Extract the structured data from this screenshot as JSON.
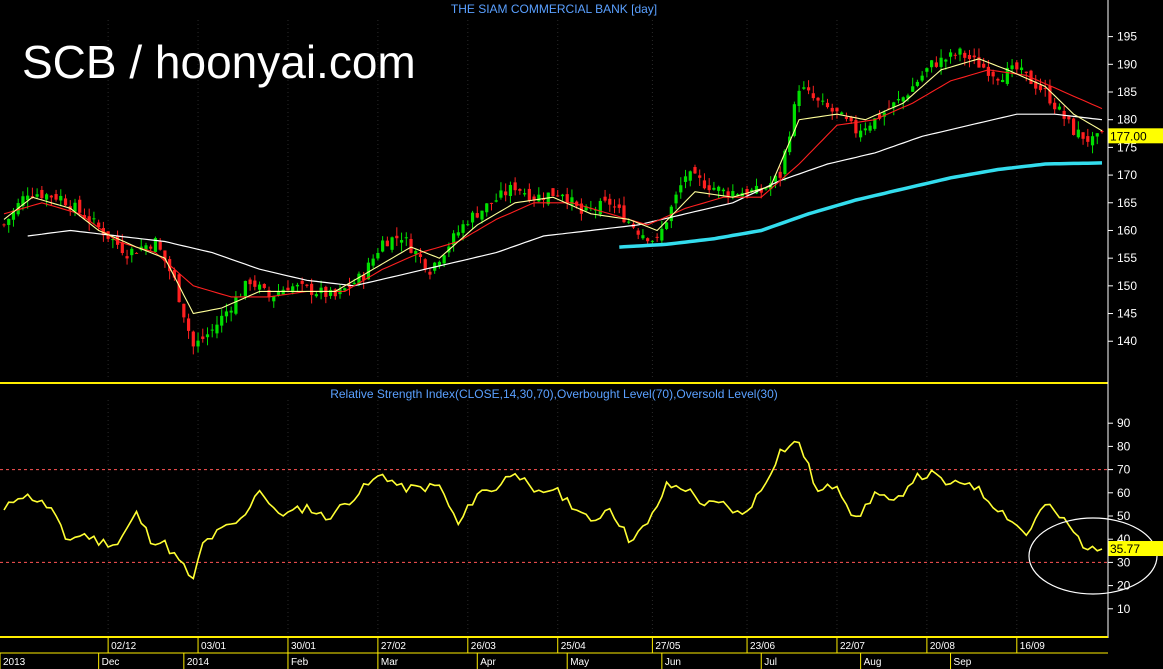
{
  "colors": {
    "background": "#000000",
    "up_candle": "#00e000",
    "down_candle": "#ff2020",
    "ma_fast": "#ffff99",
    "ma_mid": "#ff2020",
    "ma_slow": "#ffffff",
    "ma_long": "#33ddee",
    "rsi_line": "#ffff33",
    "separator": "#ffee00",
    "level_line": "#ff5555",
    "title": "#5aa0ff",
    "highlight_box": "#ffff00"
  },
  "watermark": "SCB / hoonyai.com",
  "chart_data": [
    {
      "type": "candlestick",
      "title": "THE SIAM COMMERCIAL BANK [day]",
      "ylim": [
        133,
        198
      ],
      "yticks": [
        140,
        145,
        150,
        155,
        160,
        165,
        170,
        175,
        180,
        185,
        190,
        195
      ],
      "last_price_label": "177.00",
      "last_price": 177,
      "close_anchors": [
        [
          0,
          161
        ],
        [
          5,
          167
        ],
        [
          12,
          166
        ],
        [
          18,
          162
        ],
        [
          26,
          156
        ],
        [
          32,
          158
        ],
        [
          36,
          151
        ],
        [
          40,
          139
        ],
        [
          44,
          142
        ],
        [
          52,
          151
        ],
        [
          56,
          148
        ],
        [
          60,
          150
        ],
        [
          66,
          149
        ],
        [
          70,
          148
        ],
        [
          76,
          152
        ],
        [
          80,
          158
        ],
        [
          84,
          159
        ],
        [
          90,
          153
        ],
        [
          98,
          162
        ],
        [
          108,
          168
        ],
        [
          112,
          166
        ],
        [
          118,
          167
        ],
        [
          122,
          163
        ],
        [
          128,
          165
        ],
        [
          134,
          160
        ],
        [
          138,
          158
        ],
        [
          144,
          170
        ],
        [
          152,
          167
        ],
        [
          160,
          167
        ],
        [
          164,
          170
        ],
        [
          168,
          186
        ],
        [
          172,
          183
        ],
        [
          176,
          181
        ],
        [
          180,
          178
        ],
        [
          184,
          180
        ],
        [
          190,
          184
        ],
        [
          196,
          190
        ],
        [
          202,
          192
        ],
        [
          206,
          190
        ],
        [
          210,
          188
        ],
        [
          214,
          189
        ],
        [
          220,
          185
        ],
        [
          226,
          178
        ],
        [
          230,
          176
        ],
        [
          232,
          177
        ]
      ],
      "ma_fast_anchors": [
        [
          0,
          162
        ],
        [
          6,
          166
        ],
        [
          14,
          164
        ],
        [
          20,
          160
        ],
        [
          28,
          157
        ],
        [
          34,
          155
        ],
        [
          40,
          145
        ],
        [
          46,
          146
        ],
        [
          54,
          149
        ],
        [
          62,
          149
        ],
        [
          70,
          149
        ],
        [
          78,
          153
        ],
        [
          86,
          157
        ],
        [
          92,
          155
        ],
        [
          100,
          161
        ],
        [
          108,
          165
        ],
        [
          116,
          166
        ],
        [
          124,
          163
        ],
        [
          132,
          162
        ],
        [
          138,
          160
        ],
        [
          146,
          167
        ],
        [
          154,
          166
        ],
        [
          162,
          168
        ],
        [
          168,
          180
        ],
        [
          176,
          181
        ],
        [
          182,
          180
        ],
        [
          190,
          183
        ],
        [
          198,
          189
        ],
        [
          206,
          191
        ],
        [
          212,
          189
        ],
        [
          220,
          186
        ],
        [
          226,
          181
        ],
        [
          232,
          178
        ]
      ],
      "ma_mid_anchors": [
        [
          0,
          163
        ],
        [
          8,
          165
        ],
        [
          16,
          163
        ],
        [
          24,
          158
        ],
        [
          32,
          156
        ],
        [
          40,
          150
        ],
        [
          48,
          148
        ],
        [
          56,
          148
        ],
        [
          64,
          149
        ],
        [
          72,
          149
        ],
        [
          80,
          153
        ],
        [
          88,
          156
        ],
        [
          96,
          158
        ],
        [
          104,
          162
        ],
        [
          112,
          165
        ],
        [
          120,
          165
        ],
        [
          128,
          163
        ],
        [
          136,
          161
        ],
        [
          144,
          164
        ],
        [
          152,
          166
        ],
        [
          160,
          166
        ],
        [
          168,
          172
        ],
        [
          176,
          179
        ],
        [
          184,
          180
        ],
        [
          192,
          183
        ],
        [
          200,
          187
        ],
        [
          208,
          189
        ],
        [
          216,
          188
        ],
        [
          224,
          185
        ],
        [
          232,
          182
        ]
      ],
      "ma_slow_anchors": [
        [
          5,
          159
        ],
        [
          14,
          160
        ],
        [
          24,
          159
        ],
        [
          34,
          158
        ],
        [
          44,
          156
        ],
        [
          54,
          153
        ],
        [
          64,
          151
        ],
        [
          74,
          150
        ],
        [
          84,
          152
        ],
        [
          94,
          154
        ],
        [
          104,
          156
        ],
        [
          114,
          159
        ],
        [
          124,
          160
        ],
        [
          134,
          161
        ],
        [
          144,
          163
        ],
        [
          154,
          165
        ],
        [
          164,
          169
        ],
        [
          174,
          172
        ],
        [
          184,
          174
        ],
        [
          194,
          177
        ],
        [
          204,
          179
        ],
        [
          214,
          181
        ],
        [
          222,
          181
        ],
        [
          232,
          180
        ]
      ],
      "ma_long_anchors": [
        [
          130,
          157
        ],
        [
          140,
          157.5
        ],
        [
          150,
          158.5
        ],
        [
          160,
          160
        ],
        [
          170,
          163
        ],
        [
          180,
          165.5
        ],
        [
          190,
          167.5
        ],
        [
          200,
          169.5
        ],
        [
          210,
          171
        ],
        [
          220,
          172
        ],
        [
          232,
          172.2
        ]
      ]
    },
    {
      "type": "line",
      "title": "Relative Strength Index(CLOSE,14,30,70),Overbought Level(70),Oversold Level(30)",
      "ylim": [
        0,
        100
      ],
      "yticks": [
        10,
        20,
        30,
        40,
        50,
        60,
        70,
        80,
        90
      ],
      "overbought": 70,
      "oversold": 30,
      "last_value_label": "35.77",
      "last_value": 35.77,
      "anchors": [
        [
          0,
          52
        ],
        [
          3,
          59
        ],
        [
          6,
          58
        ],
        [
          10,
          53
        ],
        [
          13,
          40
        ],
        [
          17,
          42
        ],
        [
          20,
          39
        ],
        [
          24,
          38
        ],
        [
          28,
          51
        ],
        [
          31,
          40
        ],
        [
          34,
          38
        ],
        [
          38,
          28
        ],
        [
          40,
          22
        ],
        [
          42,
          38
        ],
        [
          46,
          44
        ],
        [
          50,
          48
        ],
        [
          54,
          62
        ],
        [
          57,
          52
        ],
        [
          60,
          51
        ],
        [
          64,
          54
        ],
        [
          68,
          49
        ],
        [
          72,
          55
        ],
        [
          76,
          62
        ],
        [
          80,
          68
        ],
        [
          84,
          62
        ],
        [
          88,
          62
        ],
        [
          92,
          63
        ],
        [
          96,
          46
        ],
        [
          100,
          60
        ],
        [
          104,
          62
        ],
        [
          108,
          70
        ],
        [
          112,
          59
        ],
        [
          116,
          62
        ],
        [
          120,
          55
        ],
        [
          124,
          47
        ],
        [
          128,
          54
        ],
        [
          132,
          40
        ],
        [
          136,
          46
        ],
        [
          140,
          63
        ],
        [
          144,
          62
        ],
        [
          148,
          55
        ],
        [
          152,
          55
        ],
        [
          156,
          50
        ],
        [
          160,
          61
        ],
        [
          164,
          78
        ],
        [
          168,
          82
        ],
        [
          172,
          60
        ],
        [
          176,
          64
        ],
        [
          180,
          48
        ],
        [
          184,
          60
        ],
        [
          188,
          55
        ],
        [
          192,
          66
        ],
        [
          196,
          68
        ],
        [
          200,
          63
        ],
        [
          204,
          65
        ],
        [
          208,
          57
        ],
        [
          212,
          50
        ],
        [
          216,
          42
        ],
        [
          220,
          55
        ],
        [
          224,
          48
        ],
        [
          228,
          38
        ],
        [
          230,
          35
        ],
        [
          232,
          35.77
        ]
      ]
    }
  ],
  "x_axis": {
    "date_labels": [
      {
        "label": "02/12",
        "bar": 22
      },
      {
        "label": "03/01",
        "bar": 41
      },
      {
        "label": "30/01",
        "bar": 60
      },
      {
        "label": "27/02",
        "bar": 79
      },
      {
        "label": "26/03",
        "bar": 98
      },
      {
        "label": "25/04",
        "bar": 117
      },
      {
        "label": "27/05",
        "bar": 137
      },
      {
        "label": "23/06",
        "bar": 157
      },
      {
        "label": "22/07",
        "bar": 176
      },
      {
        "label": "20/08",
        "bar": 195
      },
      {
        "label": "16/09",
        "bar": 214
      }
    ],
    "period_labels": [
      {
        "label": "2013",
        "bar": 0
      },
      {
        "label": "Dec",
        "bar": 20
      },
      {
        "label": "2014",
        "bar": 38
      },
      {
        "label": "Feb",
        "bar": 60
      },
      {
        "label": "Mar",
        "bar": 79
      },
      {
        "label": "Apr",
        "bar": 100
      },
      {
        "label": "May",
        "bar": 119
      },
      {
        "label": "Jun",
        "bar": 139
      },
      {
        "label": "Jul",
        "bar": 160
      },
      {
        "label": "Aug",
        "bar": 181
      },
      {
        "label": "Sep",
        "bar": 200
      }
    ]
  },
  "annotation": {
    "type": "ellipse",
    "note": ""
  }
}
